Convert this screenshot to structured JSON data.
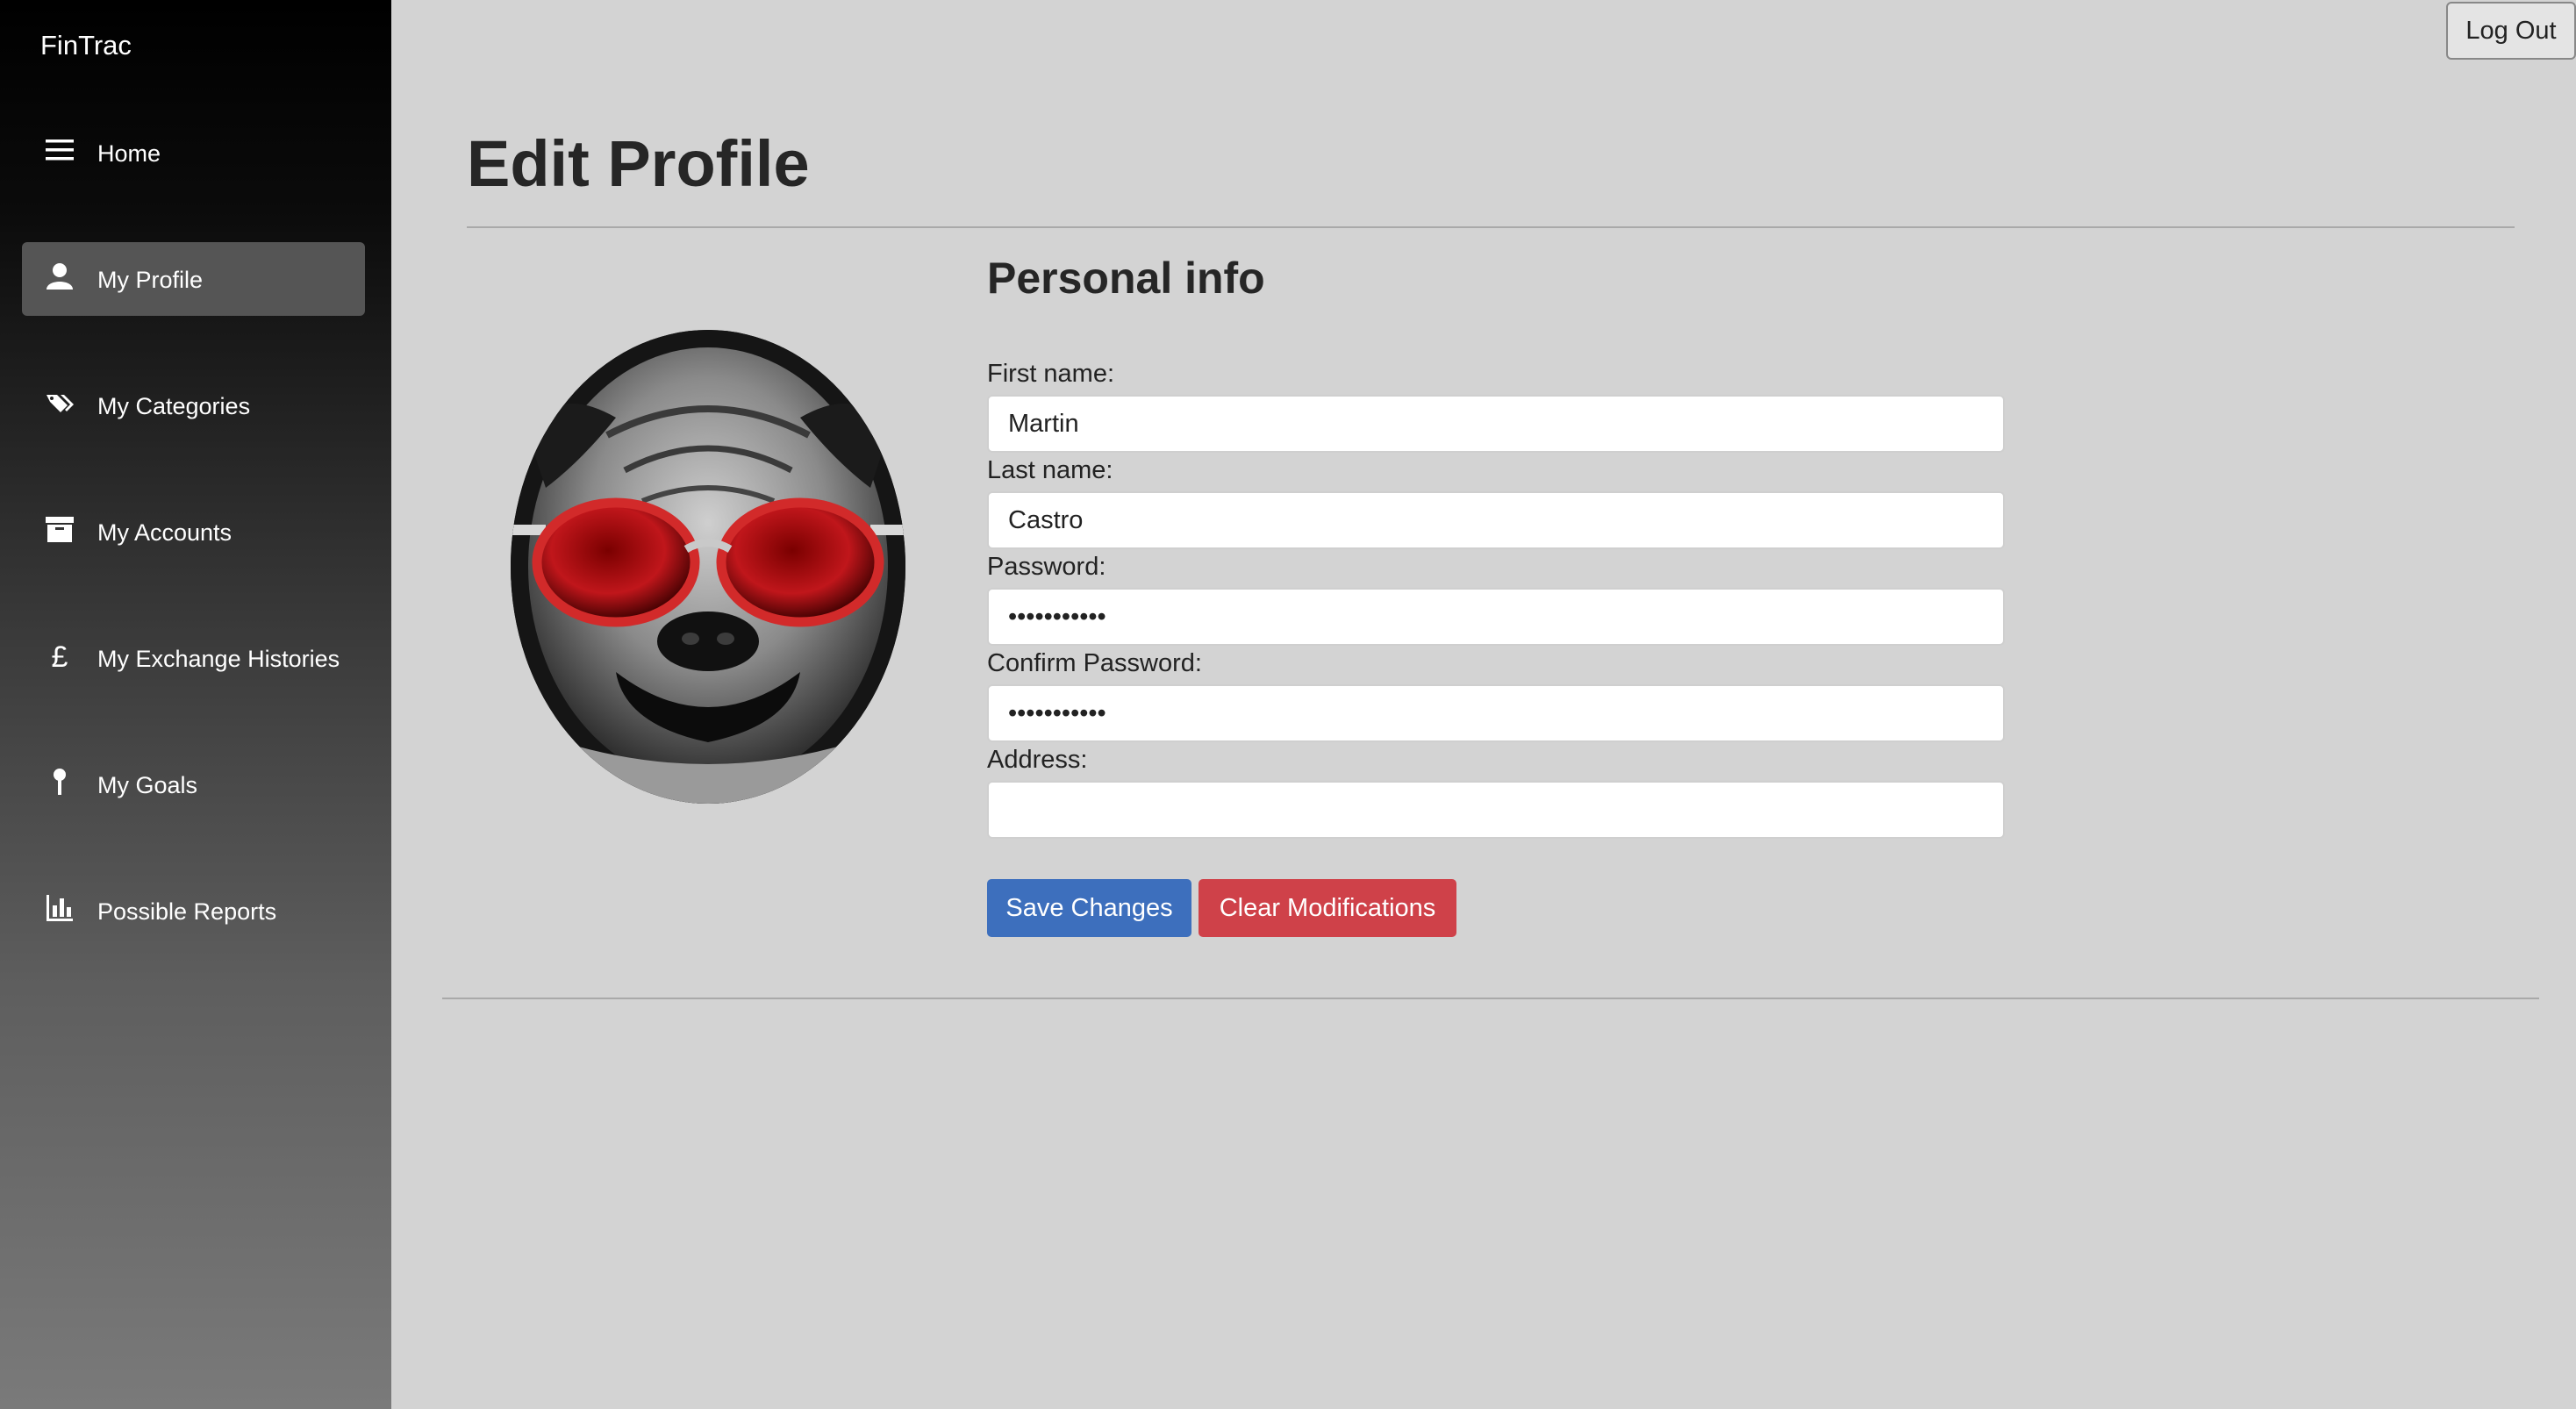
{
  "app": {
    "brand": "FinTrac"
  },
  "sidebar": {
    "items": [
      {
        "label": "Home",
        "icon": "menu-icon",
        "active": false
      },
      {
        "label": "My Profile",
        "icon": "person-icon",
        "active": true
      },
      {
        "label": "My Categories",
        "icon": "tags-icon",
        "active": false
      },
      {
        "label": "My Accounts",
        "icon": "archive-box-icon",
        "active": false
      },
      {
        "label": "My Exchange Histories",
        "icon": "pound-icon",
        "active": false
      },
      {
        "label": "My Goals",
        "icon": "pin-icon",
        "active": false
      },
      {
        "label": "Possible Reports",
        "icon": "bar-chart-icon",
        "active": false
      }
    ]
  },
  "header": {
    "logout_label": "Log Out"
  },
  "main": {
    "title": "Edit Profile",
    "section_title": "Personal info",
    "avatar": {
      "description_icon": "pug-with-red-sunglasses-avatar"
    },
    "form": {
      "first_name_label": "First name:",
      "first_name_value": "Martin",
      "last_name_label": "Last name:",
      "last_name_value": "Castro",
      "password_label": "Password:",
      "password_value": "abcdefghijk",
      "confirm_password_label": "Confirm Password:",
      "confirm_password_value": "abcdefghijk",
      "address_label": "Address:",
      "address_value": ""
    },
    "buttons": {
      "save_label": "Save Changes",
      "clear_label": "Clear Modifications"
    }
  },
  "colors": {
    "save_button": "#3d6fbd",
    "clear_button": "#cf4149",
    "active_nav": "#555555",
    "background": "#d3d3d3"
  }
}
